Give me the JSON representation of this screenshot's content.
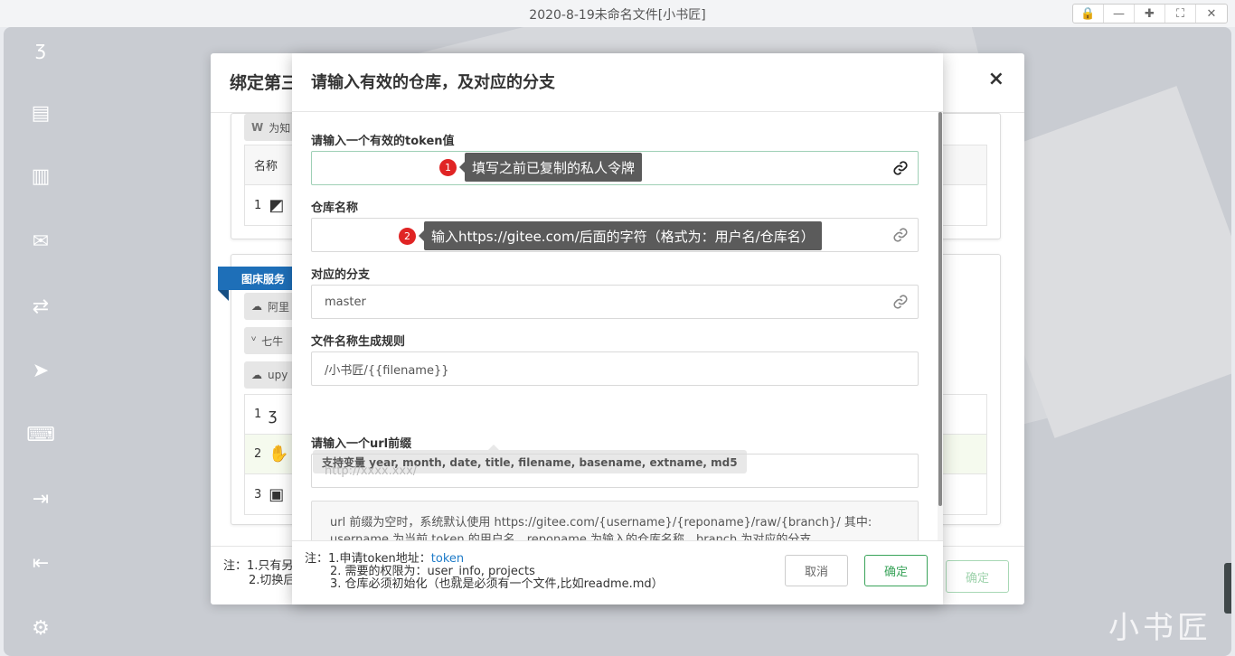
{
  "window": {
    "title": "2020-8-19未命名文件[小书匠]",
    "controls": [
      "lock-icon",
      "minimize-icon",
      "maximize-icon",
      "fullscreen-icon",
      "close-icon"
    ]
  },
  "sidebar": {
    "icons": [
      "logo-icon",
      "documents-icon",
      "files-icon",
      "mail-icon",
      "sync-icon",
      "send-icon",
      "keyboard-icon",
      "logout-icon",
      "login-icon",
      "settings-icon"
    ]
  },
  "watermark": "小书匠",
  "back_dialog": {
    "title": "绑定第三",
    "close": "×",
    "top_panel": {
      "chip_label": "为知",
      "table_header": "名称",
      "rows": [
        {
          "index": "1"
        }
      ]
    },
    "ribbon": "图床服务",
    "chips": [
      "阿里",
      "七牛",
      "upy"
    ],
    "image_rows": [
      {
        "index": "1"
      },
      {
        "index": "2"
      },
      {
        "index": "3"
      }
    ],
    "footer_note_line1": "注：1.只有另",
    "footer_note_line2": "2.切换后",
    "ok_label": "确定"
  },
  "dialog": {
    "title": "请输入有效的仓库，及对应的分支",
    "fields": {
      "token": {
        "label": "请输入一个有效的token值",
        "value": ""
      },
      "repo": {
        "label": "仓库名称",
        "value": ""
      },
      "branch": {
        "label": "对应的分支",
        "value": "master"
      },
      "filename_rule": {
        "label": "文件名称生成规则",
        "value": "/小书匠/{{filename}}"
      },
      "url_prefix": {
        "label": "请输入一个url前缀",
        "placeholder": "http://xxxx.xxx/",
        "value": ""
      }
    },
    "tip": "支持变量 year, month, date, title, filename, basename, extname, md5",
    "info_line1": "url 前缀为空时，系统默认使用 https://gitee.com/{username}/{reponame}/raw/{branch}/ 其中:",
    "info_line2": "username 为当前 token 的用户名，reponame 为输入的仓库名称，branch 为对应的分支",
    "notes": {
      "prefix": "注：",
      "line1": "1.申请token地址：",
      "line1_link": "token",
      "line2": "2. 需要的权限为：user_info, projects",
      "line3": "3. 仓库必须初始化（也就是必须有一个文件,比如readme.md）"
    },
    "cancel_label": "取消",
    "ok_label": "确定"
  },
  "callouts": [
    {
      "num": "1",
      "text": "填写之前已复制的私人令牌"
    },
    {
      "num": "2",
      "text": "输入https://gitee.com/后面的字符（格式为：用户名/仓库名）"
    }
  ],
  "colors": {
    "accent_green": "#3aa35a",
    "link_blue": "#1e7bc8",
    "callout_red": "#e02424",
    "ribbon_blue": "#1e6fb8"
  }
}
